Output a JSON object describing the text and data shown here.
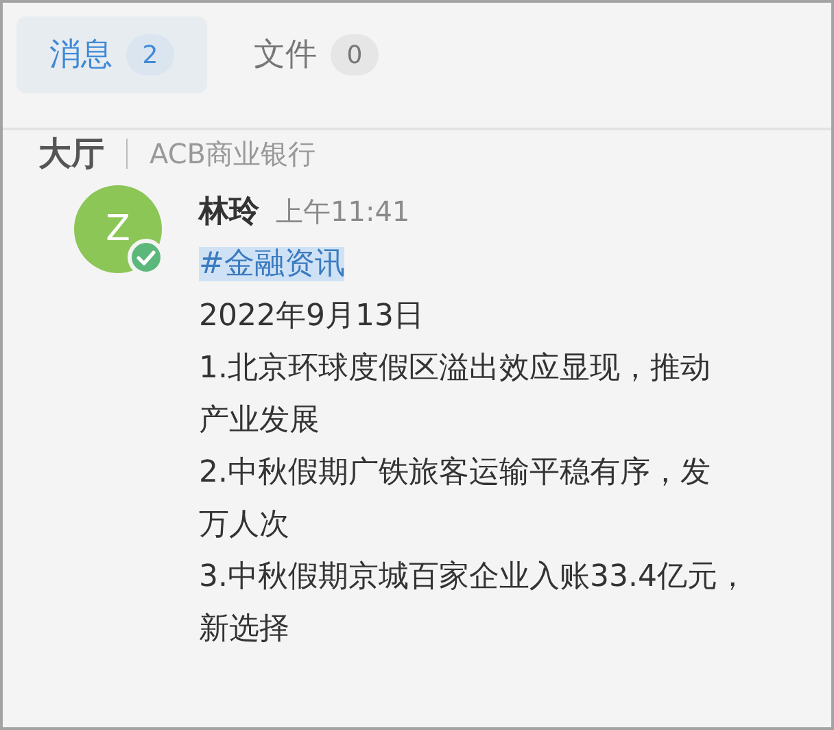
{
  "tabs": [
    {
      "label": "消息",
      "count": "2",
      "selected": true
    },
    {
      "label": "文件",
      "count": "0",
      "selected": false
    }
  ],
  "channel_header": {
    "name": "大厅",
    "org": "ACB商业银行"
  },
  "message": {
    "avatar_initial": "Z",
    "verified": true,
    "author": "林玲",
    "time": "上午11:41",
    "tag": "#金融资讯",
    "lines": [
      "2022年9月13日",
      "1.北京环球度假区溢出效应显现，推动",
      "产业发展",
      "2.中秋假期广铁旅客运输平稳有序，发",
      "万人次",
      "3.中秋假期京城百家企业入账33.4亿元，",
      "新选择"
    ]
  }
}
